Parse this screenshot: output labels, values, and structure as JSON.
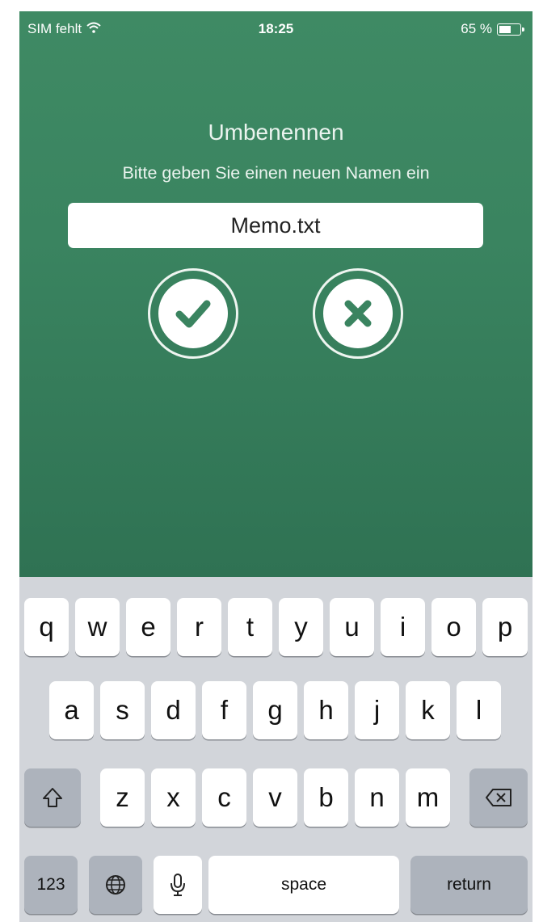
{
  "status_bar": {
    "carrier": "SIM fehlt",
    "time": "18:25",
    "battery_text": "65 %",
    "battery_level": 0.65
  },
  "dialog": {
    "title": "Umbenennen",
    "subtitle": "Bitte geben Sie einen neuen Namen ein",
    "filename_value": "Memo.txt",
    "confirm_icon": "checkmark-icon",
    "cancel_icon": "close-icon"
  },
  "colors": {
    "background_green": "#3a8460",
    "keyboard_bg": "#d2d5da"
  },
  "keyboard": {
    "row1": [
      "q",
      "w",
      "e",
      "r",
      "t",
      "y",
      "u",
      "i",
      "o",
      "p"
    ],
    "row2": [
      "a",
      "s",
      "d",
      "f",
      "g",
      "h",
      "j",
      "k",
      "l"
    ],
    "row3": [
      "z",
      "x",
      "c",
      "v",
      "b",
      "n",
      "m"
    ],
    "numbers_label": "123",
    "space_label": "space",
    "return_label": "return",
    "shift_icon": "shift-icon",
    "delete_icon": "backspace-icon",
    "globe_icon": "globe-icon",
    "mic_icon": "microphone-icon"
  }
}
